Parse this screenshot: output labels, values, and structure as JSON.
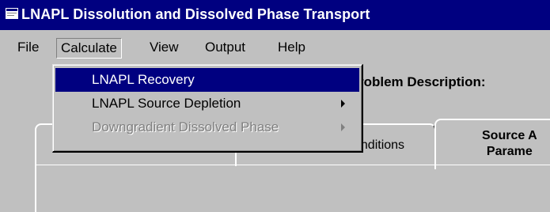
{
  "window": {
    "title": "LNAPL Dissolution and Dissolved Phase Transport",
    "icon": "app-window-icon"
  },
  "menubar": {
    "items": [
      "File",
      "Calculate",
      "View",
      "Output",
      "Help"
    ],
    "active": "Calculate"
  },
  "calculate_menu": {
    "items": [
      {
        "label": "LNAPL Recovery",
        "state": "highlighted",
        "submenu": false
      },
      {
        "label": "LNAPL Source Depletion",
        "state": "enabled",
        "submenu": true
      },
      {
        "label": "Downgradient Dissolved Phase",
        "state": "disabled",
        "submenu": true
      }
    ]
  },
  "content": {
    "partial_label": "roblem Description:"
  },
  "tabs": {
    "mid_label": "onditions",
    "right_label_line1": "Source A",
    "right_label_line2": "Parame"
  },
  "colors": {
    "titlebar": "#000080",
    "face": "#c0c0c0",
    "highlight": "#000080"
  }
}
